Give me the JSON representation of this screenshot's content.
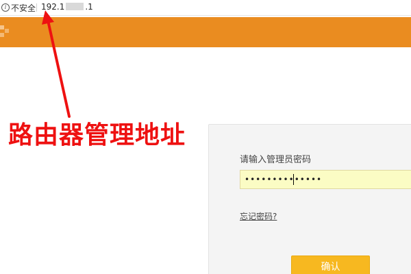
{
  "browser": {
    "security_label": "不安全",
    "url_start": "192.1",
    "url_end": ".1",
    "info_icon": "info-icon"
  },
  "annotation": {
    "text": "路由器管理地址",
    "color": "#ee1111"
  },
  "login": {
    "password_label": "请输入管理员密码",
    "password_value": "••••••••••••••",
    "forgot_link": "忘记密码?",
    "confirm_label": "确认"
  },
  "colors": {
    "header": "#ea8c20",
    "button": "#f7b820",
    "input_bg": "#fbfcc4",
    "arrow": "#ee1111"
  }
}
